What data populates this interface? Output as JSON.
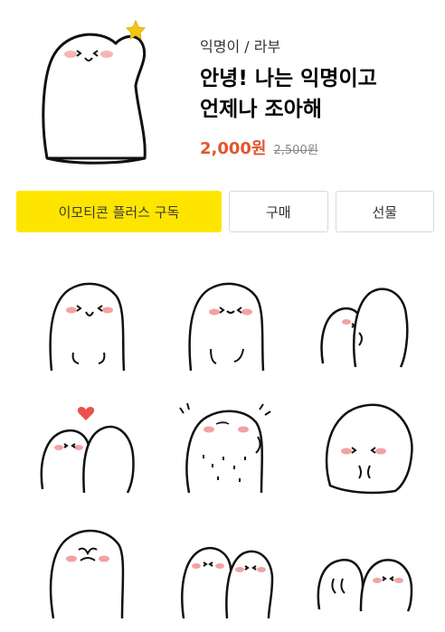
{
  "product": {
    "author": "익명이 / 라부",
    "title_line1": "안녕! 나는 익명이고",
    "title_line2": "언제나 조아해",
    "price": "2,000원",
    "original_price": "2,500원"
  },
  "actions": {
    "subscribe_label": "이모티콘 플러스 구독",
    "buy_label": "구매",
    "gift_label": "선물"
  },
  "icons": {
    "hero": "ghost-waving-with-star-icon",
    "stickers": [
      "ghost-smiling-icon",
      "ghost-hands-down-icon",
      "ghosts-hugging-icon",
      "ghosts-with-heart-icon",
      "ghost-sweating-icon",
      "ghost-leaning-icon",
      "ghost-covering-face-icon",
      "ghost-friends-icon",
      "ghosts-peeking-icon"
    ]
  },
  "colors": {
    "accent_yellow": "#fee500",
    "price_red": "#e1562e",
    "blush": "#f2a2a2",
    "star": "#f5c518"
  }
}
